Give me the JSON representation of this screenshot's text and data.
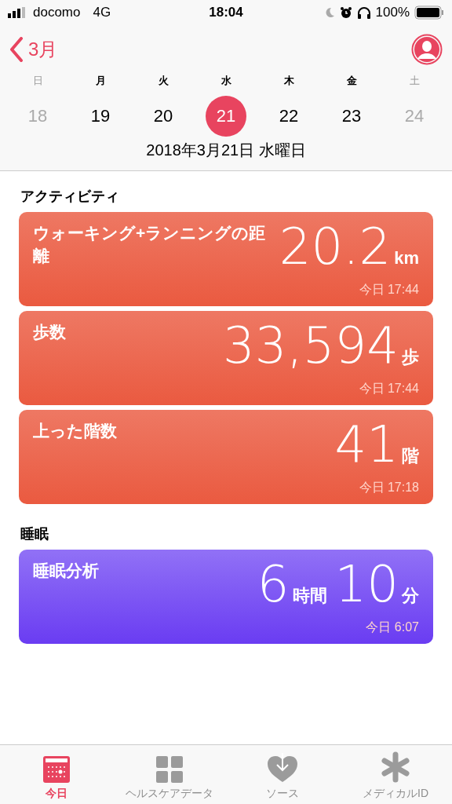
{
  "status_bar": {
    "carrier": "docomo",
    "network": "4G",
    "time": "18:04",
    "battery": "100%"
  },
  "header": {
    "back": "3月"
  },
  "week": [
    {
      "weekday": "日",
      "date": "18",
      "muted": true,
      "selected": false
    },
    {
      "weekday": "月",
      "date": "19",
      "muted": false,
      "selected": false
    },
    {
      "weekday": "火",
      "date": "20",
      "muted": false,
      "selected": false
    },
    {
      "weekday": "水",
      "date": "21",
      "muted": false,
      "selected": true
    },
    {
      "weekday": "木",
      "date": "22",
      "muted": false,
      "selected": false
    },
    {
      "weekday": "金",
      "date": "23",
      "muted": false,
      "selected": false
    },
    {
      "weekday": "土",
      "date": "24",
      "muted": true,
      "selected": false
    }
  ],
  "full_date": "2018年3月21日 水曜日",
  "sections": [
    {
      "title": "アクティビティ",
      "kind": "activity",
      "cards": [
        {
          "label": "ウォーキング+ランニングの距離",
          "value": [
            {
              "number": "20.2",
              "unit": "km"
            }
          ],
          "time": "今日 17:44"
        },
        {
          "label": "歩数",
          "value": [
            {
              "number": "33,594",
              "unit": "歩"
            }
          ],
          "time": "今日 17:44"
        },
        {
          "label": "上った階数",
          "value": [
            {
              "number": "41",
              "unit": "階"
            }
          ],
          "time": "今日 17:18"
        }
      ]
    },
    {
      "title": "睡眠",
      "kind": "sleep",
      "cards": [
        {
          "label": "睡眠分析",
          "value": [
            {
              "number": "6",
              "unit": "時間"
            },
            {
              "number": "10",
              "unit": "分"
            }
          ],
          "time": "今日 6:07"
        }
      ]
    }
  ],
  "tabs": [
    {
      "label": "今日",
      "kind": "today",
      "selected": true
    },
    {
      "label": "ヘルスケアデータ",
      "kind": "data",
      "selected": false
    },
    {
      "label": "ソース",
      "kind": "sources",
      "selected": false
    },
    {
      "label": "メディカルID",
      "kind": "medical",
      "selected": false
    }
  ]
}
